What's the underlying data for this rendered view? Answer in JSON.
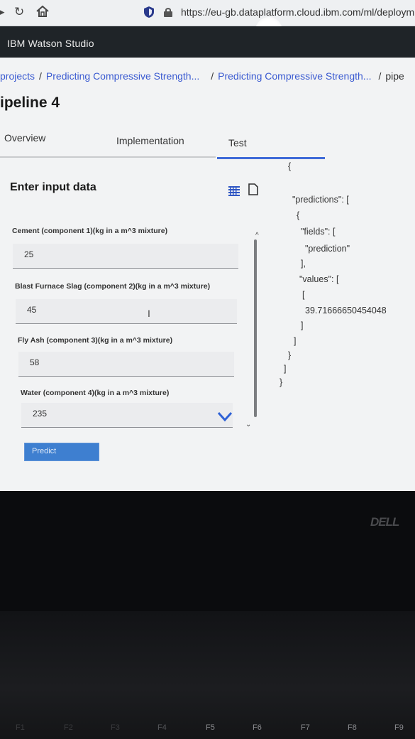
{
  "browser": {
    "url": "https://eu-gb.dataplatform.cloud.ibm.com/ml/deploym"
  },
  "app": {
    "title": "IBM Watson Studio"
  },
  "breadcrumb": {
    "items": [
      "projects",
      "Predicting Compressive Strength...",
      "Predicting Compressive Strength...",
      "pipe"
    ],
    "separator": "/"
  },
  "page": {
    "title": "ipeline 4"
  },
  "tabs": [
    {
      "label": "Overview",
      "active": false
    },
    {
      "label": "Implementation",
      "active": false
    },
    {
      "label": "Test",
      "active": true
    }
  ],
  "form": {
    "heading": "Enter input data",
    "fields": [
      {
        "label": "Cement (component 1)(kg in a m^3 mixture)",
        "value": "25"
      },
      {
        "label": "Blast Furnace Slag (component 2)(kg in a m^3 mixture)",
        "value": "45"
      },
      {
        "label": "Fly Ash (component 3)(kg in a m^3 mixture)",
        "value": "58"
      },
      {
        "label": "Water (component 4)(kg in a m^3 mixture)",
        "value": "235"
      }
    ],
    "predict_label": "Predict"
  },
  "output": {
    "lines": [
      "{",
      "\"predictions\": [",
      "{",
      "\"fields\": [",
      "\"prediction\"",
      "],",
      "\"values\": [",
      "[",
      "39.71666650454048",
      "]",
      "]",
      "}",
      "]",
      "}"
    ]
  },
  "bezel": {
    "brand": "DELL",
    "fkeys": [
      "F1",
      "F2",
      "F3",
      "F4",
      "F5",
      "F6",
      "F7",
      "F8",
      "F9"
    ]
  },
  "colors": {
    "accent": "#3f6ad8",
    "header_bg": "#1f2428",
    "button_bg": "#3e7fd0"
  }
}
